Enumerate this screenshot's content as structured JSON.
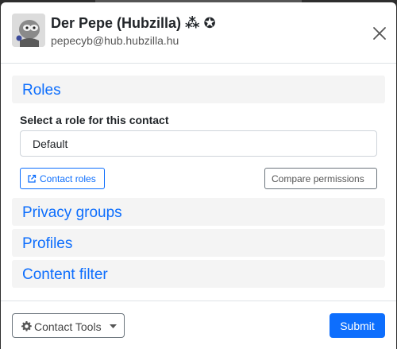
{
  "contact": {
    "name": "Der Pepe (Hubzilla) ⁂ ✪",
    "address": "pepecyb@hub.hubzilla.hu"
  },
  "sections": {
    "roles": "Roles",
    "privacy_groups": "Privacy groups",
    "profiles": "Profiles",
    "content_filter": "Content filter"
  },
  "roles": {
    "label": "Select a role for this contact",
    "selected": "Default",
    "contact_roles_button": "Contact roles",
    "compare_button": "Compare permissions"
  },
  "footer": {
    "tools_button": "Contact Tools",
    "submit_button": "Submit"
  },
  "icons": {
    "close": "close-icon",
    "external_link": "external-link-icon",
    "gear": "gear-icon",
    "caret": "caret-down-icon"
  },
  "colors": {
    "accent": "#0d6efd",
    "section_bg": "#f4f4f4"
  }
}
